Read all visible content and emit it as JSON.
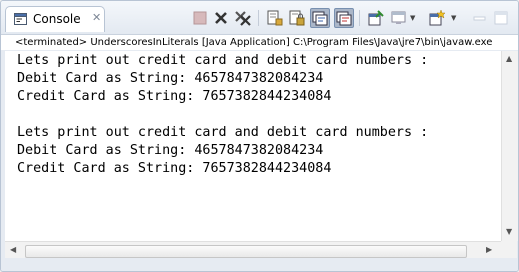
{
  "window": {
    "tab_label": "Console"
  },
  "toolbar": {
    "buttons": [
      "terminate-icon",
      "remove-launch-icon",
      "remove-all-icon",
      "clear-console-icon",
      "scroll-lock-icon",
      "word-wrap-icon",
      "show-on-output-icon",
      "pin-console-icon",
      "display-console-icon",
      "open-console-icon",
      "minimize-icon",
      "maximize-icon"
    ]
  },
  "status": {
    "text": "<terminated> UnderscoresInLiterals [Java Application] C:\\Program Files\\Java\\jre7\\bin\\javaw.exe"
  },
  "console": {
    "lines": [
      "Lets print out credit card and debit card numbers :",
      "Debit Card as String: 4657847382084234",
      "Credit Card as String: 7657382844234084",
      "",
      "Lets print out credit card and debit card numbers :",
      "Debit Card as String: 4657847382084234",
      "Credit Card as String: 7657382844234084"
    ]
  }
}
